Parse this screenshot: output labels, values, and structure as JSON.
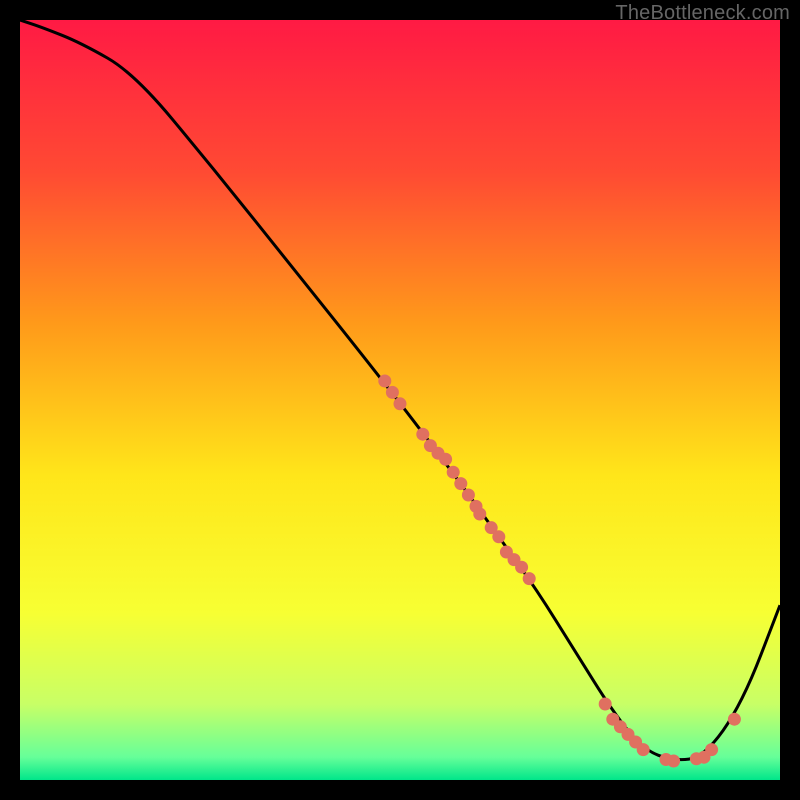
{
  "attribution": "TheBottleneck.com",
  "chart_data": {
    "type": "line",
    "title": "",
    "xlabel": "",
    "ylabel": "",
    "xlim": [
      0,
      100
    ],
    "ylim": [
      0,
      100
    ],
    "background_gradient": {
      "stops": [
        {
          "pos": 0.0,
          "color": "#ff1a44"
        },
        {
          "pos": 0.2,
          "color": "#ff4a33"
        },
        {
          "pos": 0.4,
          "color": "#ff9a1a"
        },
        {
          "pos": 0.6,
          "color": "#ffe61a"
        },
        {
          "pos": 0.78,
          "color": "#f7ff33"
        },
        {
          "pos": 0.9,
          "color": "#c8ff66"
        },
        {
          "pos": 0.97,
          "color": "#66ff99"
        },
        {
          "pos": 1.0,
          "color": "#00e68a"
        }
      ]
    },
    "series": [
      {
        "name": "bottleneck-curve",
        "x": [
          0,
          3,
          8,
          15,
          25,
          35,
          45,
          52,
          58,
          63,
          68,
          73,
          78,
          82,
          86,
          90,
          95,
          100
        ],
        "y": [
          100,
          99,
          97,
          93,
          81,
          68.5,
          56,
          47,
          39,
          32,
          25,
          17,
          9,
          4,
          2.5,
          3,
          10,
          23
        ],
        "color": "#000000"
      }
    ],
    "points": {
      "name": "sample-points",
      "color": "#e07060",
      "coords": [
        {
          "x": 48,
          "y": 52.5
        },
        {
          "x": 49,
          "y": 51
        },
        {
          "x": 50,
          "y": 49.5
        },
        {
          "x": 53,
          "y": 45.5
        },
        {
          "x": 54,
          "y": 44
        },
        {
          "x": 55,
          "y": 43
        },
        {
          "x": 56,
          "y": 42.2
        },
        {
          "x": 57,
          "y": 40.5
        },
        {
          "x": 58,
          "y": 39
        },
        {
          "x": 59,
          "y": 37.5
        },
        {
          "x": 60,
          "y": 36
        },
        {
          "x": 60.5,
          "y": 35
        },
        {
          "x": 62,
          "y": 33.2
        },
        {
          "x": 63,
          "y": 32
        },
        {
          "x": 64,
          "y": 30
        },
        {
          "x": 65,
          "y": 29
        },
        {
          "x": 66,
          "y": 28
        },
        {
          "x": 67,
          "y": 26.5
        },
        {
          "x": 77,
          "y": 10
        },
        {
          "x": 78,
          "y": 8
        },
        {
          "x": 79,
          "y": 7
        },
        {
          "x": 80,
          "y": 6
        },
        {
          "x": 81,
          "y": 5
        },
        {
          "x": 82,
          "y": 4
        },
        {
          "x": 85,
          "y": 2.7
        },
        {
          "x": 86,
          "y": 2.5
        },
        {
          "x": 89,
          "y": 2.8
        },
        {
          "x": 90,
          "y": 3
        },
        {
          "x": 91,
          "y": 4
        },
        {
          "x": 94,
          "y": 8
        }
      ]
    }
  }
}
